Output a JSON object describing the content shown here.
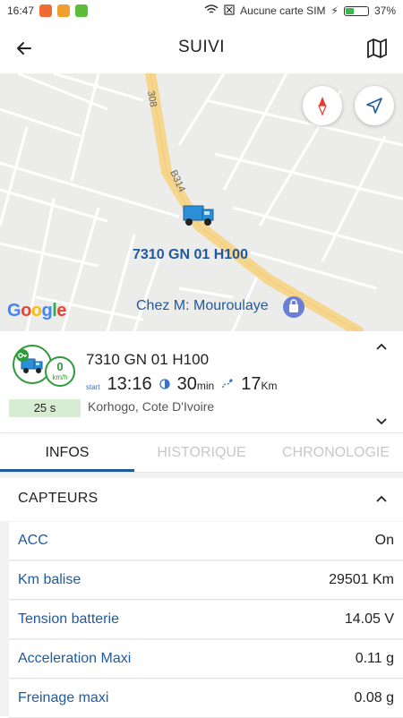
{
  "status_bar": {
    "time": "16:47",
    "sim": "Aucune carte SIM",
    "battery": "37%",
    "battery_level": 0.37
  },
  "header": {
    "title": "SUIVI",
    "back_icon": "arrow-left-icon",
    "map_icon": "map-icon"
  },
  "map": {
    "road_labels": [
      "308",
      "B314"
    ],
    "vehicle_label": "7310 GN 01 H100",
    "poi_label": "Chez M: Mouroulaye",
    "brand": "Google",
    "buttons": [
      "compass-icon",
      "navigation-icon"
    ]
  },
  "vehicle": {
    "name": "7310 GN 01 H100",
    "speed": "0",
    "speed_unit": "km/h",
    "timer": "25 s",
    "start_label": "start",
    "start_time": "13:16",
    "duration": "30",
    "duration_unit": "min",
    "distance": "17",
    "distance_unit": "Km",
    "location": "Korhogo, Cote D'Ivoire"
  },
  "tabs": [
    {
      "label": "INFOS",
      "active": true
    },
    {
      "label": "HISTORIQUE",
      "active": false
    },
    {
      "label": "CHRONOLOGIE",
      "active": false
    }
  ],
  "sensors": {
    "title": "CAPTEURS",
    "rows": [
      {
        "label": "ACC",
        "value": "On"
      },
      {
        "label": "Km balise",
        "value": "29501 Km"
      },
      {
        "label": "Tension batterie",
        "value": "14.05 V"
      },
      {
        "label": "Acceleration Maxi",
        "value": "0.11 g"
      },
      {
        "label": "Freinage maxi",
        "value": "0.08 g"
      }
    ]
  },
  "colors": {
    "accent": "#1f5a9e",
    "green": "#2e9b3a",
    "road": "#f6d58d"
  }
}
